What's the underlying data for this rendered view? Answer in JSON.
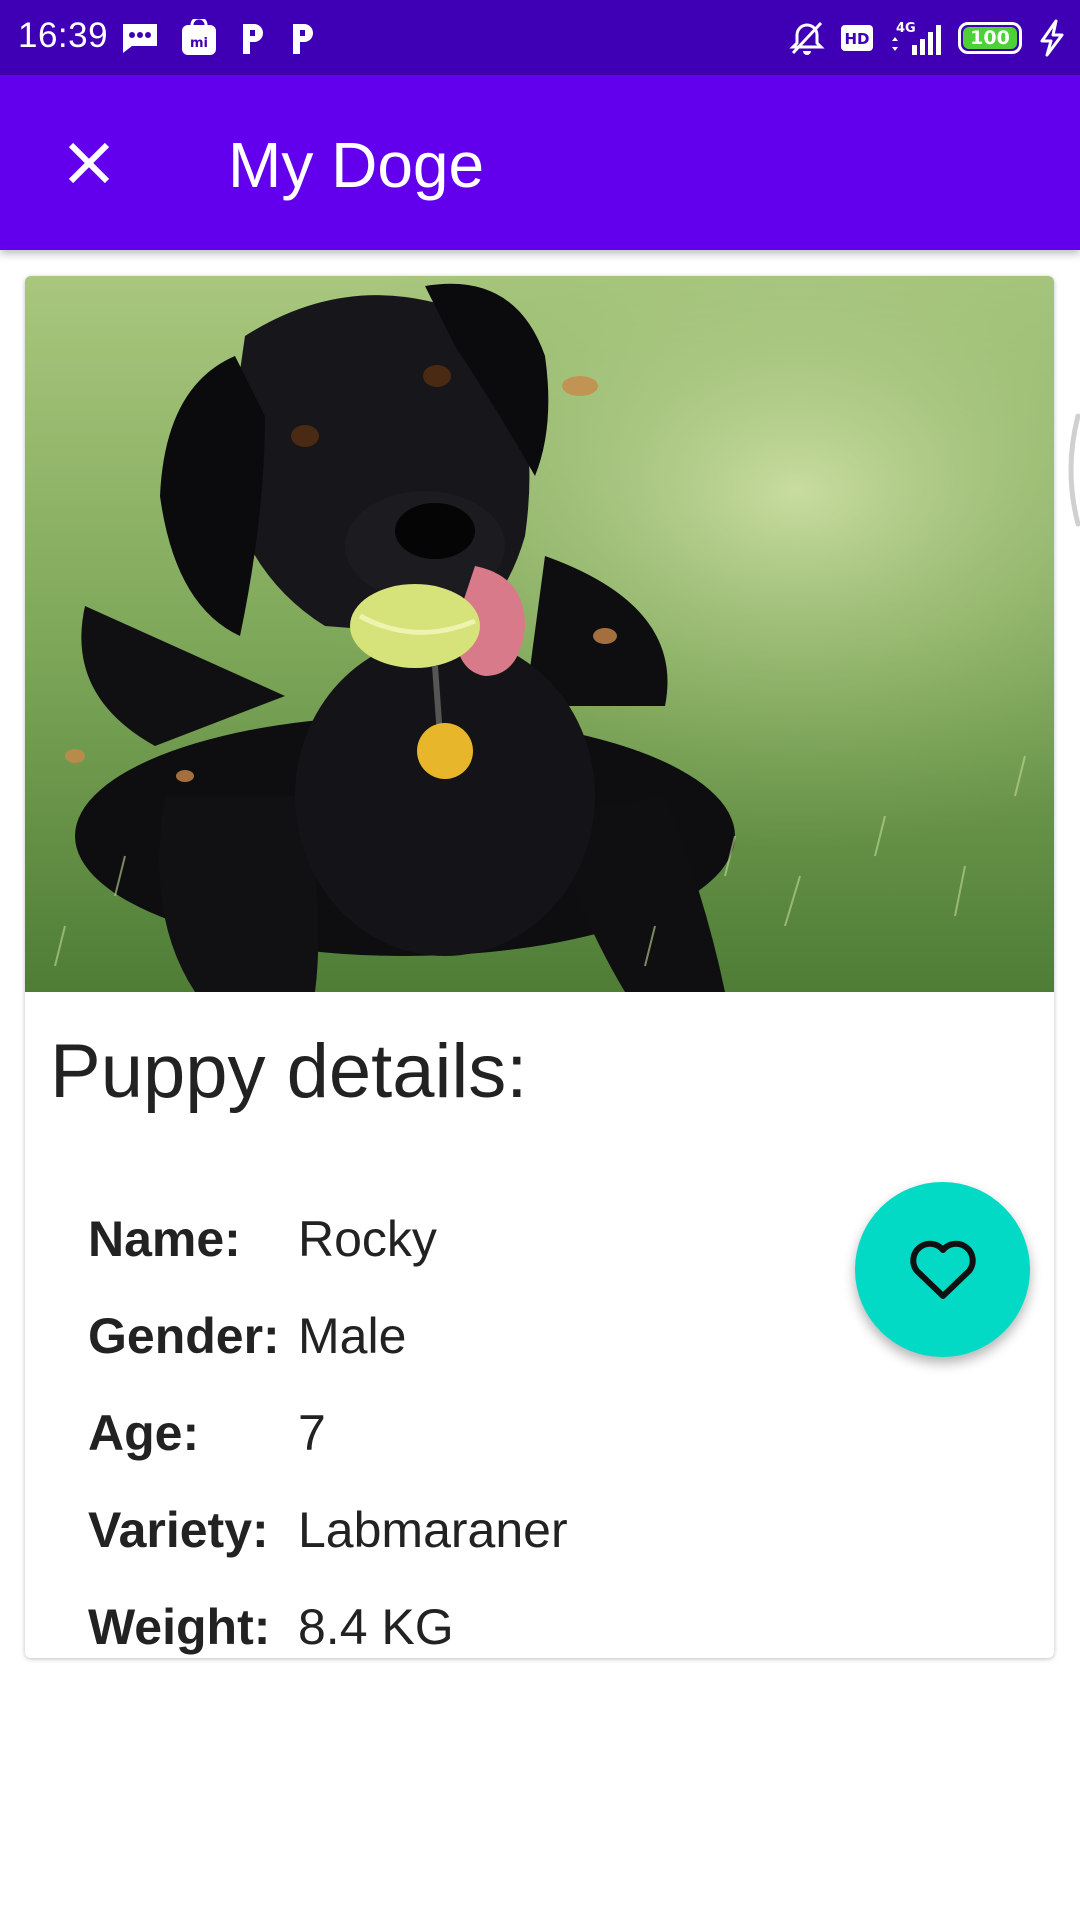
{
  "status_bar": {
    "time": "16:39",
    "left_icons": [
      "message-icon",
      "mi-store-icon",
      "p-app-icon",
      "p-app-icon"
    ],
    "right_icons": [
      "alarm-off-icon",
      "hd-icon",
      "4g-signal-icon",
      "battery-icon",
      "charging-icon"
    ],
    "hd_label": "HD",
    "network_label": "4G",
    "battery_level": "100"
  },
  "app_bar": {
    "title": "My Doge",
    "close_icon": "close-icon"
  },
  "card": {
    "image_alt": "black-dog-with-tennis-ball-photo",
    "heading": "Puppy details:",
    "details": [
      {
        "label": "Name:",
        "value": "Rocky"
      },
      {
        "label": "Gender:",
        "value": "Male"
      },
      {
        "label": "Age:",
        "value": "7"
      },
      {
        "label": "Variety:",
        "value": "Labmaraner"
      },
      {
        "label": "Weight:",
        "value": "8.4 KG"
      }
    ],
    "fab_icon": "heart-outline-icon"
  },
  "colors": {
    "status_bar": "#3f00b5",
    "app_bar": "#6200ee",
    "fab": "#03dac5",
    "text": "#222222"
  }
}
